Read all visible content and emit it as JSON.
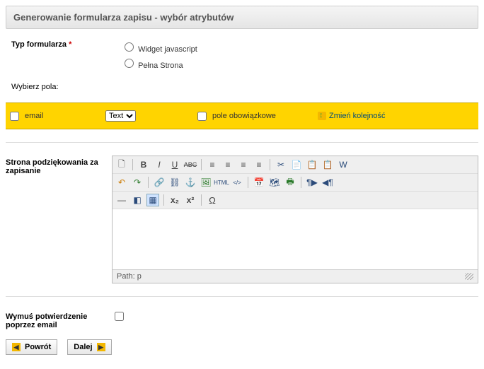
{
  "header": {
    "title": "Generowanie formularza zapisu - wybór atrybutów"
  },
  "formTypeRow": {
    "label": "Typ formularza",
    "required": "*",
    "options": {
      "widget": "Widget javascript",
      "fullpage": "Pełna Strona"
    }
  },
  "fieldsSection": {
    "title": "Wybierz pola:",
    "emailLabel": "email",
    "typeSelected": "Text",
    "mandatoryLabel": "pole obowiązkowe",
    "reorderLabel": "Zmień kolejność"
  },
  "thankYouRow": {
    "label": "Strona podziękowania za zapisanie",
    "pathLabel": "Path: p"
  },
  "toolbar": {
    "r1": {
      "newdoc": "🗋",
      "bold": "B",
      "italic": "I",
      "underline": "U",
      "strike": "ABC",
      "alignleft": "≡",
      "aligncenter": "≡",
      "alignright": "≡",
      "alignjustify": "≡",
      "cut": "✂",
      "copy": "📄",
      "paste": "📋",
      "pastetext": "📋",
      "pasteword": "W"
    },
    "r2": {
      "undo": "↶",
      "redo": "↷",
      "link": "🔗",
      "unlink": "⛓",
      "anchor": "⚓",
      "image": "🖼",
      "html": "HTML",
      "code": "</>",
      "date": "📅",
      "map": "🗺",
      "print": "🖶",
      "ltr": "¶▶",
      "rtl": "◀¶"
    },
    "r3": {
      "hr": "—",
      "erase": "◧",
      "table": "▦",
      "sub": "x₂",
      "sup": "x²",
      "char": "Ω"
    }
  },
  "confirmRow": {
    "label": "Wymuś potwierdzenie poprzez email"
  },
  "buttons": {
    "back": "Powrót",
    "next": "Dalej"
  }
}
